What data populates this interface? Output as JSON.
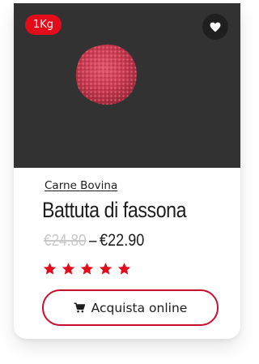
{
  "product": {
    "weight_badge": "1Kg",
    "category": "Carne Bovina",
    "title": "Battuta di fassona",
    "old_price": "€24.80",
    "price_separator": "–",
    "price": "€22.90",
    "rating": 5,
    "rating_max": 5,
    "cta_label": "Acquista online",
    "icons": {
      "wishlist": "heart-icon",
      "cart": "cart-icon",
      "rating": "star-icon"
    }
  },
  "colors": {
    "accent": "#e20c1a",
    "star": "#e20c1a",
    "cta_border": "#c8102e",
    "image_background": "#323232",
    "meat": "#c73a4f"
  }
}
